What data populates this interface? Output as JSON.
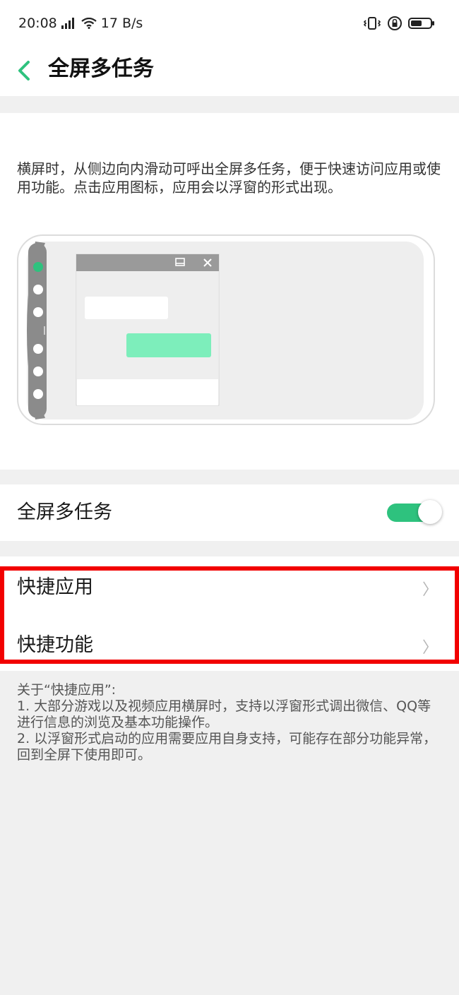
{
  "status_bar": {
    "time": "20:08",
    "net_speed": "17 B/s",
    "icons": [
      "signal-icon",
      "wifi-icon",
      "vibrate-icon",
      "lock-rotation-icon",
      "battery-icon"
    ]
  },
  "nav": {
    "title": "全屏多任务"
  },
  "intro": {
    "description": "横屏时，从侧边向内滑动可呼出全屏多任务，便于快速访问应用或使用功能。点击应用图标，应用会以浮窗的形式出现。"
  },
  "settings": {
    "toggle_label": "全屏多任务",
    "toggle_on": true,
    "accent_color": "#2ec27e"
  },
  "list": {
    "items": [
      {
        "label": "快捷应用",
        "chevron": "〉"
      },
      {
        "label": "快捷功能",
        "chevron": "〉"
      }
    ]
  },
  "notes": {
    "heading": "关于“快捷应用”:",
    "item1": "1. 大部分游戏以及视频应用横屏时，支持以浮窗形式调出微信、QQ等进行信息的浏览及基本功能操作。",
    "item2": "2. 以浮窗形式启动的应用需要应用自身支持，可能存在部分功能异常，回到全屏下使用即可。"
  },
  "highlight_color": "#f20000"
}
